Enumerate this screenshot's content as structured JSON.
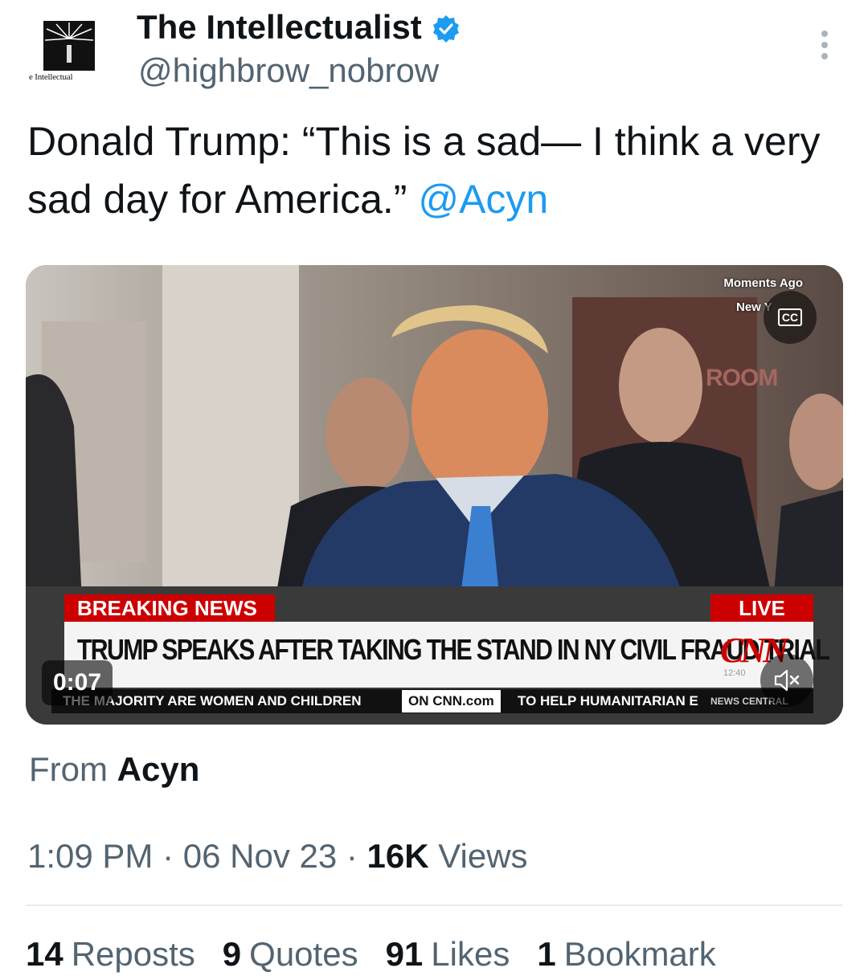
{
  "author": {
    "avatar_caption": "e Intellectual",
    "display_name": "The Intellectualist",
    "handle": "@highbrow_nobrow",
    "verified": true
  },
  "tweet": {
    "text": "Donald Trump: “This is a sad— I think a very sad day for America.”",
    "mention": "@Acyn"
  },
  "video": {
    "corner_tag": "Moments Ago",
    "corner_tag2": "New Y",
    "cc_label": "CC",
    "breaking_label": "BREAKING NEWS",
    "live_label": "LIVE",
    "headline": "TRUMP SPEAKS AFTER TAKING THE STAND IN NY CIVIL FRAUD TRIAL",
    "logo": "CNN",
    "time_small": "12:40",
    "ticker_left": "THE MAJORITY ARE WOMEN AND CHILDREN",
    "ticker_oncnn": "ON CNN.com",
    "ticker_right": "TO HELP HUMANITARIAN E",
    "ticker_tag": "NEWS CENTRAL",
    "timestamp": "0:07",
    "bg_sign": "ROOM"
  },
  "attribution": {
    "from_label": "From",
    "source": "Acyn"
  },
  "meta": {
    "time": "1:09 PM",
    "date": "06 Nov 23",
    "views_count": "16K",
    "views_label": "Views"
  },
  "stats": {
    "reposts_count": "14",
    "reposts_label": "Reposts",
    "quotes_count": "9",
    "quotes_label": "Quotes",
    "likes_count": "91",
    "likes_label": "Likes",
    "bookmarks_count": "1",
    "bookmarks_label": "Bookmark"
  },
  "colors": {
    "accent": "#1d9bf0",
    "text": "#0f1419",
    "secondary": "#536471",
    "cnn_red": "#cc0000"
  }
}
